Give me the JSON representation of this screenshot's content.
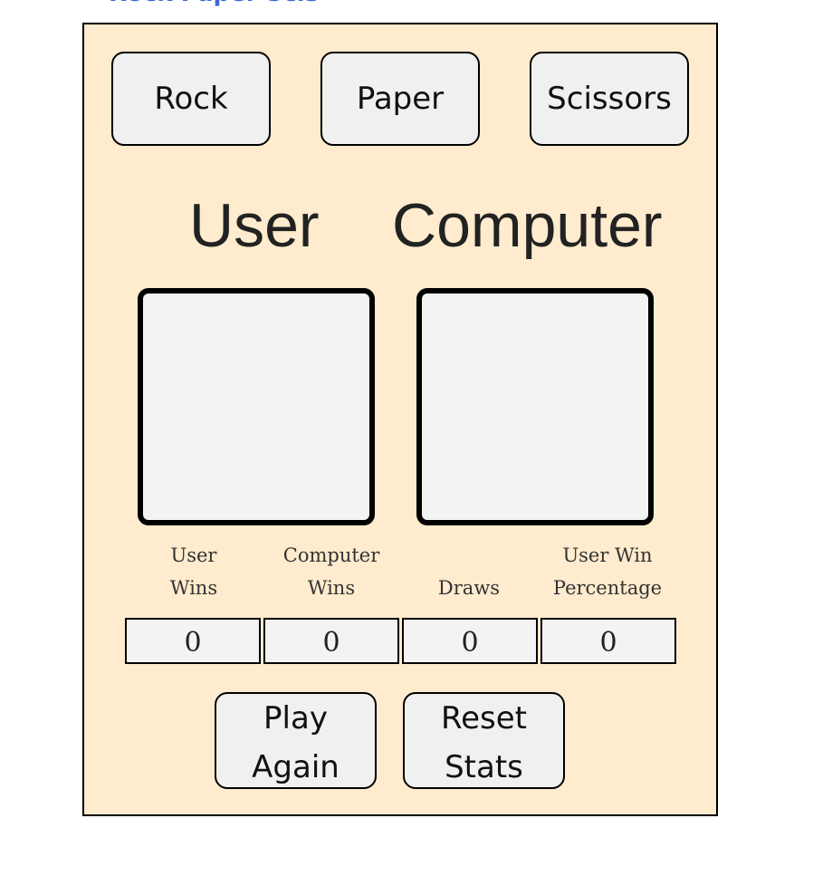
{
  "header": {
    "clipped_title": "Rock Paper Scissors"
  },
  "choices": {
    "rock": "Rock",
    "paper": "Paper",
    "scissors": "Scissors"
  },
  "players": {
    "user_label": "User",
    "computer_label": "Computer",
    "user_choice": "",
    "computer_choice": ""
  },
  "stats": {
    "user_wins_label": [
      "User",
      "Wins"
    ],
    "computer_wins_label": [
      "Computer",
      "Wins"
    ],
    "draws_label": [
      "",
      "Draws"
    ],
    "user_win_pct_label": [
      "User Win",
      "Percentage"
    ],
    "user_wins": "0",
    "computer_wins": "0",
    "draws": "0",
    "user_win_percentage": "0"
  },
  "actions": {
    "play_again": [
      "Play",
      "Again"
    ],
    "reset_stats": [
      "Reset",
      "Stats"
    ]
  },
  "colors": {
    "panel_background": "#ffebcd",
    "button_background": "#f0f0f0",
    "box_background": "#f3f3f3",
    "title_blue": "#3b66d8"
  }
}
